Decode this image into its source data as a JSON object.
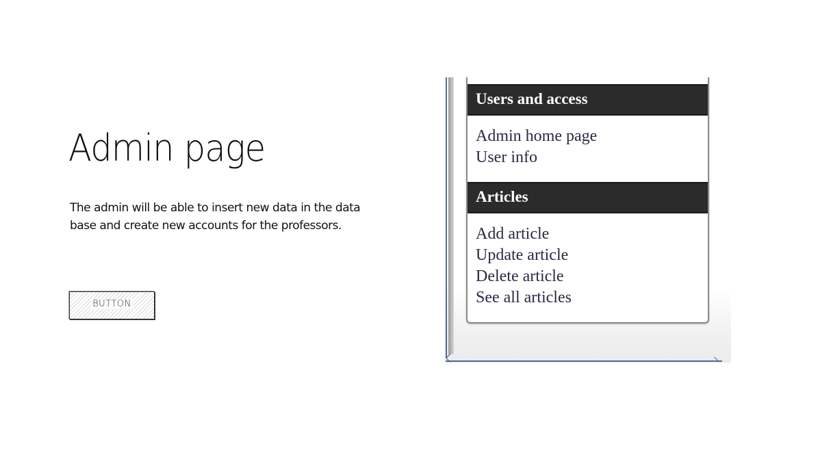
{
  "page": {
    "title": "Admin page",
    "description": "The admin will be able to insert new data in the data base and create new accounts for the professors.",
    "button_label": "BUTTON"
  },
  "menu": {
    "sections": [
      {
        "header": "Users and access",
        "links": [
          "Admin home page",
          "User info"
        ]
      },
      {
        "header": "Articles",
        "links": [
          "Add article",
          "Update article",
          "Delete article",
          "See all articles"
        ]
      }
    ]
  },
  "colors": {
    "header_bg": "#2b2b2b",
    "header_text": "#ffffff",
    "link_text": "#2a2a44",
    "frame_line": "#4a6a9a"
  }
}
